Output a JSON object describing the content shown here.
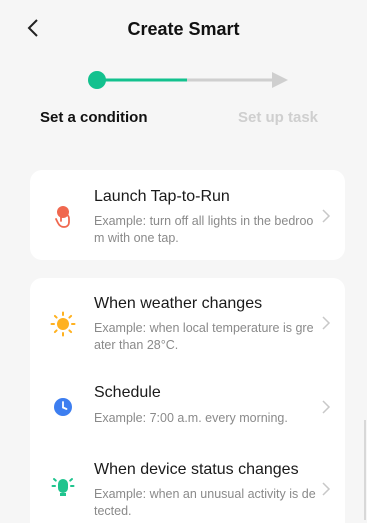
{
  "header": {
    "title": "Create Smart"
  },
  "steps": {
    "step1_label": "Set a condition",
    "step2_label": "Set up task"
  },
  "colors": {
    "accent": "#13c18e",
    "inactive": "#cfcfcf"
  },
  "tap_to_run": {
    "title": "Launch Tap-to-Run",
    "desc": "Example: turn off all lights in the bedroom with one tap.",
    "icon": "tap-hand-icon"
  },
  "conditions": [
    {
      "title": "When weather changes",
      "desc": "Example: when local temperature is greater than 28°C.",
      "icon": "sun-icon"
    },
    {
      "title": "Schedule",
      "desc": "Example: 7:00 a.m. every morning.",
      "icon": "clock-icon"
    },
    {
      "title": "When device status changes",
      "desc": "Example: when an unusual activity is detected.",
      "icon": "device-icon"
    }
  ]
}
